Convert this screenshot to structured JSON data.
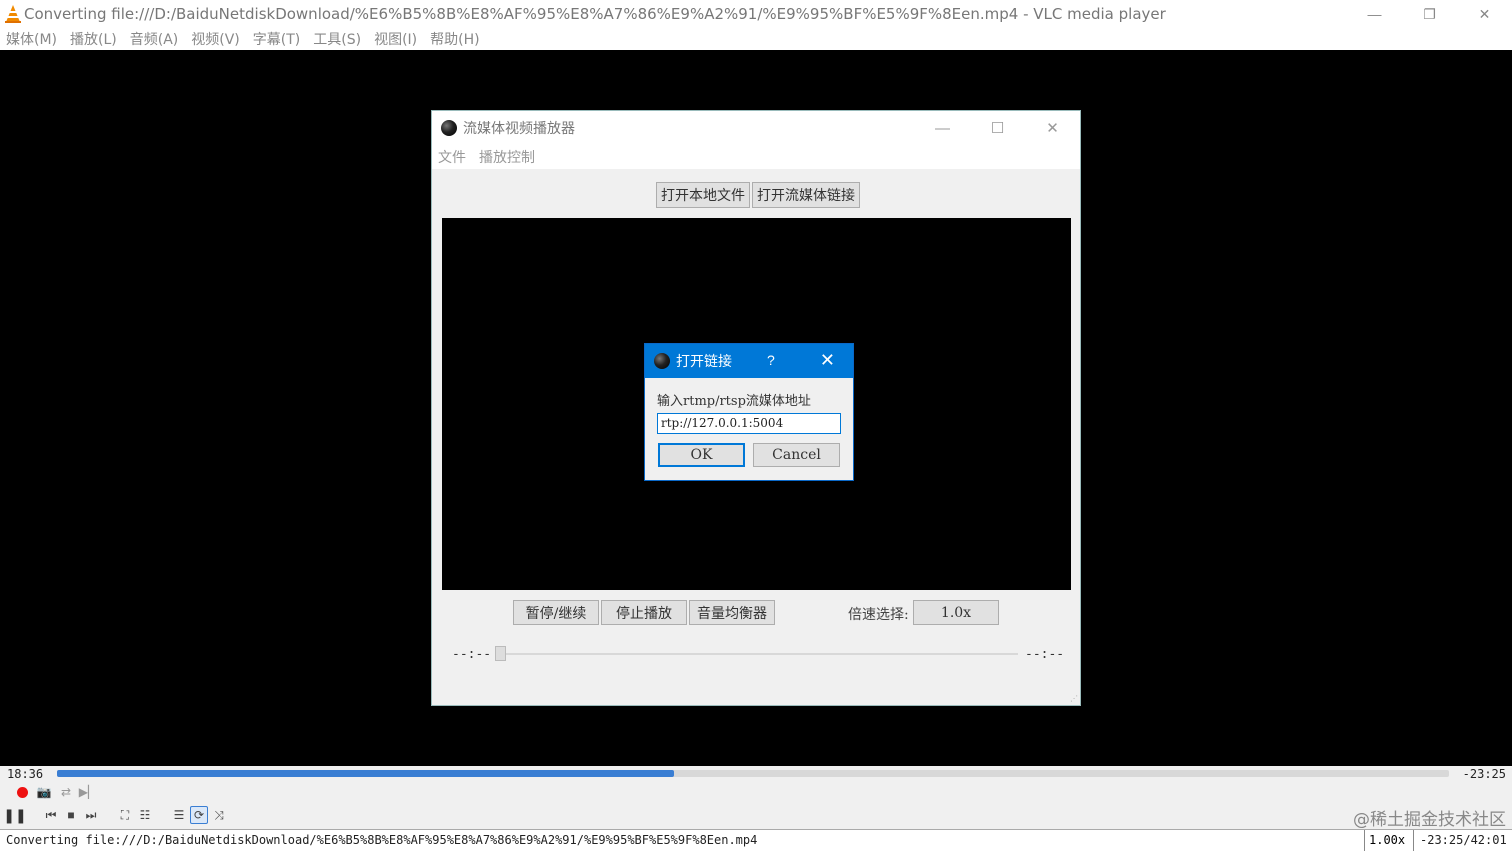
{
  "vlc": {
    "title": "Converting file:///D:/BaiduNetdiskDownload/%E6%B5%8B%E8%AF%95%E8%A7%86%E9%A2%91/%E9%95%BF%E5%9F%8Een.mp4 - VLC media player",
    "menus": [
      "媒体(M)",
      "播放(L)",
      "音频(A)",
      "视频(V)",
      "字幕(T)",
      "工具(S)",
      "视图(I)",
      "帮助(H)"
    ],
    "elapsed": "18:36",
    "remaining": "-23:25",
    "progress_fraction": 0.443,
    "status_text": "Converting file:///D:/BaiduNetdiskDownload/%E6%B5%8B%E8%AF%95%E8%A7%86%E9%A2%91/%E9%95%BF%E5%9F%8Een.mp4",
    "speed": "1.00x",
    "time_total": "-23:25/42:01",
    "watermark": "@稀土掘金技术社区",
    "icons": {
      "minimize": "minimize-icon",
      "restore": "restore-icon",
      "close": "close-icon"
    },
    "accent_color": "#3a7ed3"
  },
  "app": {
    "title": "流媒体视频播放器",
    "menus": [
      "文件",
      "播放控制"
    ],
    "open_local": "打开本地文件",
    "open_stream": "打开流媒体链接",
    "pause_resume": "暂停/继续",
    "stop": "停止播放",
    "equalizer": "音量均衡器",
    "speed_label": "倍速选择:",
    "speed_value": "1.0x",
    "time_left": "--:--",
    "time_right": "--:--"
  },
  "dialog": {
    "title": "打开链接",
    "help": "?",
    "prompt": "输入rtmp/rtsp流媒体地址",
    "input_value": "rtp://127.0.0.1:5004",
    "ok": "OK",
    "cancel": "Cancel",
    "title_color": "#0078d7"
  }
}
